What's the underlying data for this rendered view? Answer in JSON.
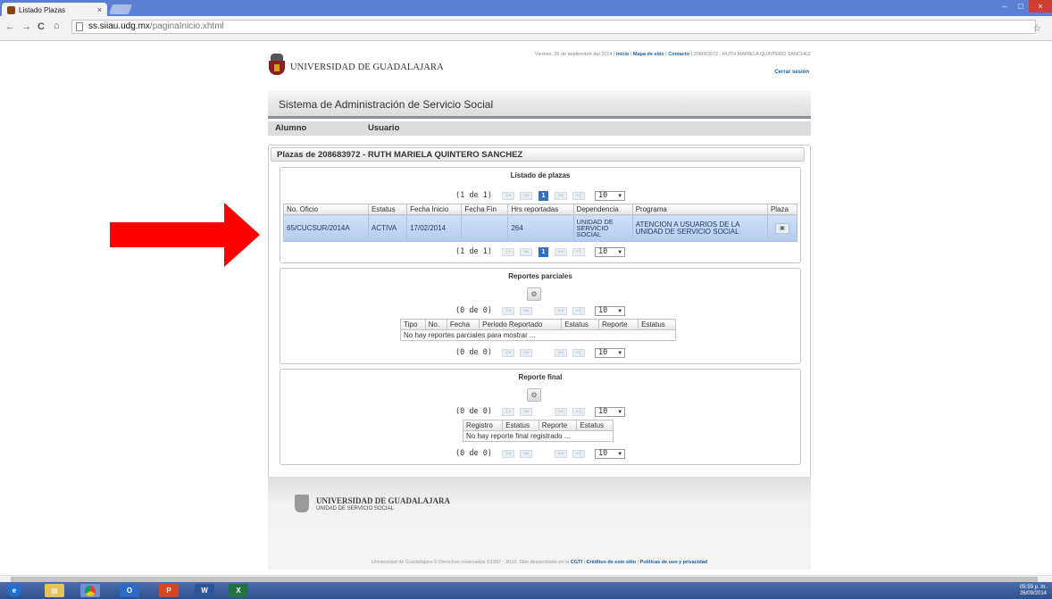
{
  "browser": {
    "tab_title": "Listado Plazas",
    "tab_close": "×",
    "url_host": "ss.siiau.udg.mx",
    "url_path": "/paginaInicio.xhtml",
    "back": "←",
    "forward": "→",
    "reload": "C",
    "home": "⌂",
    "star": "☆",
    "menu": "≡"
  },
  "header": {
    "date_text": "Viernes, 26 de septiembre del 2014",
    "sep": "|",
    "link_inicio": "Inicio",
    "link_mapa": "Mapa de sitio",
    "link_contacto": "Contacto",
    "user": "208683972 - RUTH MARIELA QUINTERO SANCHEZ",
    "logo_text": "UNIVERSIDAD DE GUADALAJARA",
    "logout": "Cerrar sesión"
  },
  "system_title": "Sistema de Administración de Servicio Social",
  "menu": {
    "alumno": "Alumno",
    "usuario": "Usuario"
  },
  "panel_title": "Plazas de 208683972 - RUTH MARIELA QUINTERO SANCHEZ",
  "plazas": {
    "legend": "Listado de plazas",
    "page_info": "(1 de 1)",
    "current_page": "1",
    "rows_per_page": "10",
    "headers": [
      "No. Oficio",
      "Estatus",
      "Fecha Inicio",
      "Fecha Fin",
      "Hrs reportadas",
      "Dependencia",
      "Programa",
      "Plaza"
    ],
    "row": {
      "oficio": "65/CUCSUR/2014A",
      "estatus": "ACTIVA",
      "fecha_inicio": "17/02/2014",
      "fecha_fin": "",
      "hrs": "264",
      "dependencia_1": "UNIDAD DE",
      "dependencia_2": "SERVICIO",
      "dependencia_3": "SOCIAL",
      "programa_1": "ATENCION A USUARIOS DE LA",
      "programa_2": "UNIDAD DE SERVICIO SOCIAL"
    }
  },
  "parciales": {
    "legend": "Reportes parciales",
    "page_info": "(0 de 0)",
    "rows_per_page": "10",
    "headers": [
      "Tipo",
      "No.",
      "Fecha",
      "Periodo Reportado",
      "Estatus",
      "Reporte",
      "Estatus"
    ],
    "empty": "No hay reportes parciales para mostrar ..."
  },
  "final": {
    "legend": "Reporte final",
    "page_info": "(0 de 0)",
    "rows_per_page": "10",
    "headers": [
      "Registro",
      "Estatus",
      "Reporte",
      "Estatus"
    ],
    "empty": "No hay reporte final registrado ..."
  },
  "footer": {
    "logo_text": "UNIVERSIDAD DE GUADALAJARA",
    "unit": "UNIDAD DE SERVICIO SOCIAL",
    "copy_pre": "Universidad de Guadalajara © Derechos reservados ©1997 - 2010. Sitio desarrollado en la",
    "cgti": "CGTI",
    "creditos": "Créditos de este sitio",
    "politicas": "Políticas de uso y privacidad"
  },
  "taskbar": {
    "clock_time": "05:59 p. m.",
    "clock_date": "26/09/2014"
  },
  "colors": {
    "arrow": "#ff0000",
    "accent": "#2f6fc4",
    "selected_row": "#c3d8f5"
  }
}
